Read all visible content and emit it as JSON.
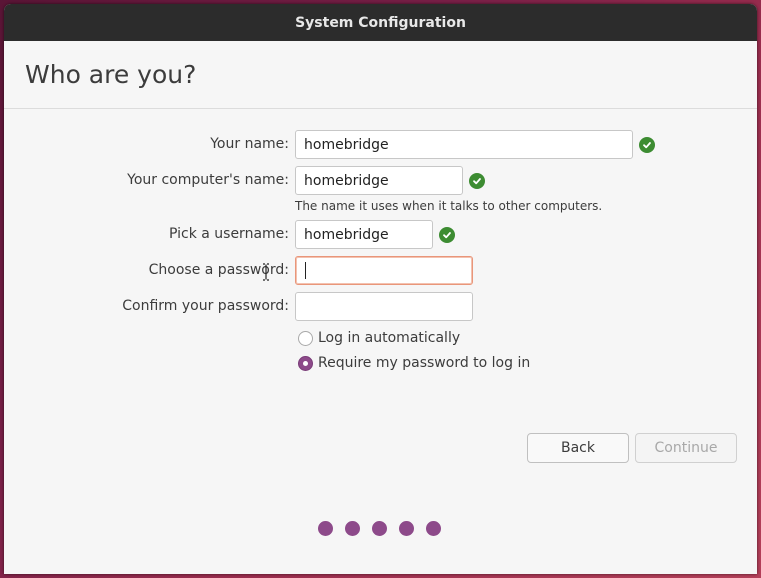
{
  "window": {
    "title": "System Configuration"
  },
  "page": {
    "heading": "Who are you?"
  },
  "form": {
    "name_label": "Your name:",
    "name_value": "homebridge",
    "computer_label": "Your computer's name:",
    "computer_value": "homebridge",
    "computer_hint": "The name it uses when it talks to other computers.",
    "username_label": "Pick a username:",
    "username_value": "homebridge",
    "password_label": "Choose a password:",
    "password_value": "",
    "confirm_label": "Confirm your password:",
    "confirm_value": "",
    "login_auto_label": "Log in automatically",
    "login_password_label": "Require my password to log in",
    "selected_login_option": "Require my password to log in"
  },
  "buttons": {
    "back": "Back",
    "continue": "Continue"
  },
  "progress": {
    "total_steps": 5
  },
  "colors": {
    "accent": "#8d4a8a",
    "valid": "#3d8c32",
    "focus_border": "#e9967a"
  },
  "icons": {
    "valid": "check-circle-icon"
  }
}
